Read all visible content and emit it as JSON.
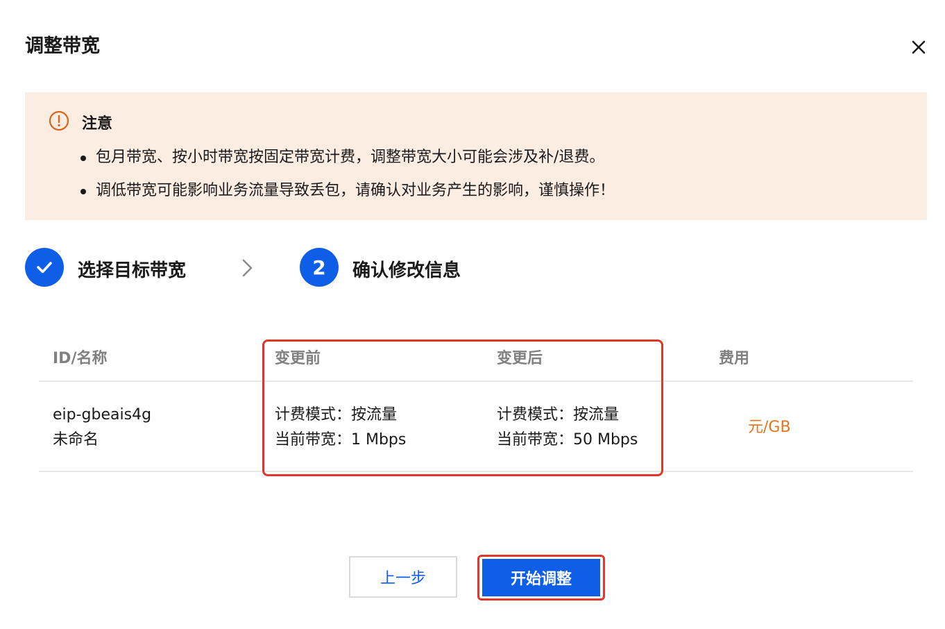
{
  "dialog": {
    "title": "调整带宽",
    "close_icon": "close-icon"
  },
  "notice": {
    "icon": "warning-circle-icon",
    "title": "注意",
    "items": [
      "包月带宽、按小时带宽按固定带宽计费，调整带宽大小可能会涉及补/退费。",
      "调低带宽可能影响业务流量导致丢包，请确认对业务产生的影响，谨慎操作！"
    ]
  },
  "steps": [
    {
      "label": "选择目标带宽",
      "status": "done",
      "icon": "check-icon"
    },
    {
      "label": "确认修改信息",
      "status": "current",
      "number": "2"
    }
  ],
  "table": {
    "headers": [
      "ID/名称",
      "变更前",
      "变更后",
      "费用"
    ],
    "rows": [
      {
        "id": "eip-gbeais4g",
        "name": "未命名",
        "before_billing": "计费模式：按流量",
        "before_bandwidth": "当前带宽：1 Mbps",
        "after_billing": "计费模式：按流量",
        "after_bandwidth": "当前带宽：50 Mbps",
        "fee": "元/GB"
      }
    ]
  },
  "buttons": {
    "prev": "上一步",
    "start": "开始调整"
  },
  "colors": {
    "primary": "#0f5ee8",
    "notice_bg": "#fcede3",
    "highlight": "#e2362b",
    "fee": "#e8741a"
  }
}
